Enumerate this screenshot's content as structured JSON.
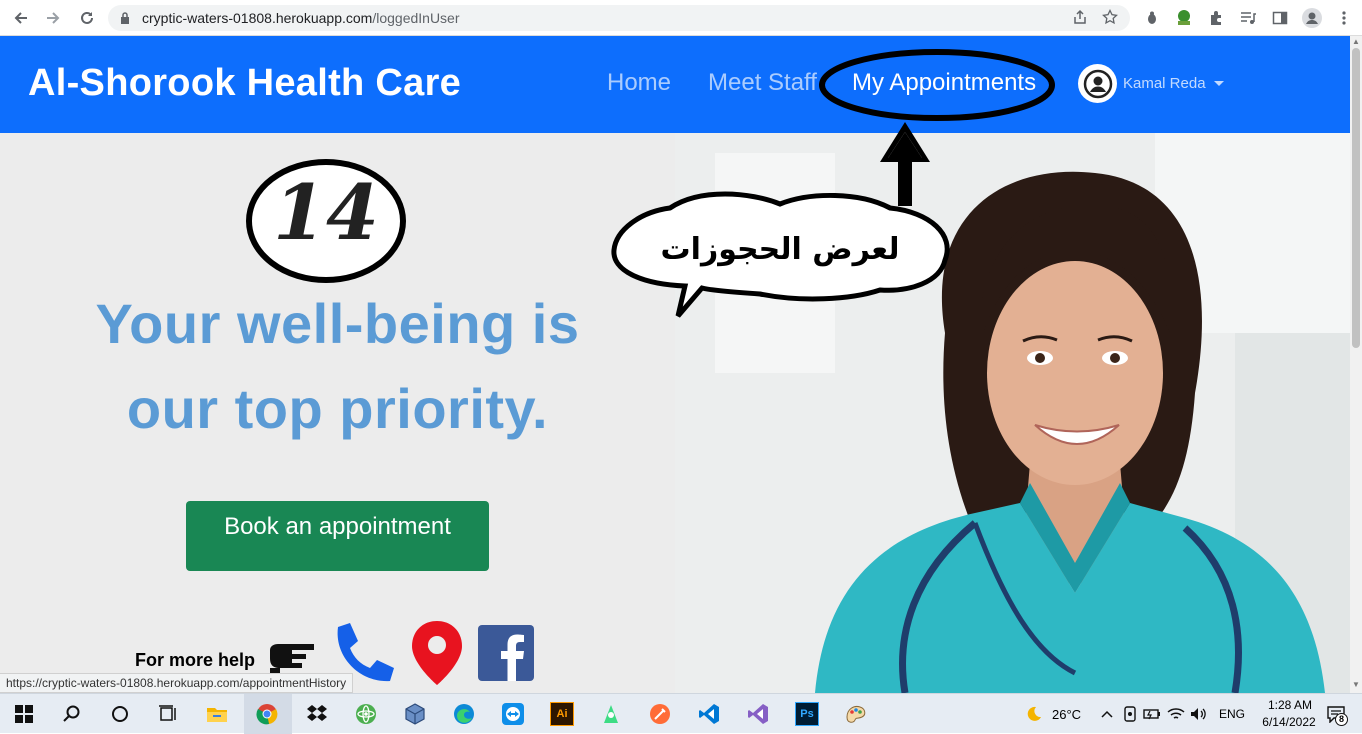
{
  "browser": {
    "url_host": "cryptic-waters-01808.herokuapp.com",
    "url_path": "/loggedInUser",
    "status_url": "https://cryptic-waters-01808.herokuapp.com/appointmentHistory"
  },
  "nav": {
    "brand": "Al-Shorook Health Care",
    "links": [
      "Home",
      "Meet Staff",
      "My Appointments"
    ],
    "user_name": "Kamal Reda"
  },
  "annotation": {
    "step_number": "14",
    "bubble_text": "لعرض الحجوزات"
  },
  "hero": {
    "headline_line1": "Your well-being is",
    "headline_line2": "our top priority.",
    "book_button": "Book an appointment",
    "help_text": "For more help"
  },
  "taskbar": {
    "weather": "26°C",
    "language": "ENG",
    "time": "1:28 AM",
    "date": "6/14/2022",
    "notification_count": "8",
    "apps": [
      "start",
      "search",
      "cortana",
      "task-view",
      "file-explorer",
      "chrome",
      "dropbox",
      "atom",
      "virtualbox",
      "edge",
      "teamviewer",
      "illustrator",
      "android-studio",
      "postman",
      "vscode",
      "visual-studio",
      "photoshop",
      "paint"
    ]
  },
  "colors": {
    "nav_bg": "#0d6efd",
    "headline": "#5b9bd5",
    "book_button": "#198754",
    "scrubs": "#2fb8c4"
  }
}
